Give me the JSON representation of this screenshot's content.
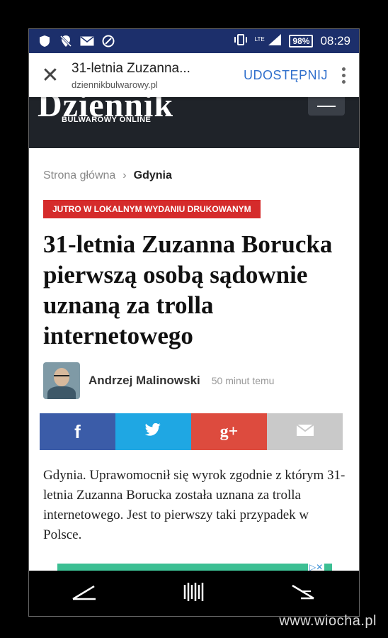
{
  "status_bar": {
    "battery": "98%",
    "network": "LTE",
    "time": "08:29"
  },
  "tab_bar": {
    "title": "31-letnia Zuzanna...",
    "url": "dziennikbulwarowy.pl",
    "share_label": "UDOSTĘPNIJ"
  },
  "site": {
    "logo": "Dziennik",
    "logo_sub": "BULWAROWY ONLINE"
  },
  "article": {
    "breadcrumb_home": "Strona główna",
    "breadcrumb_sep": "›",
    "breadcrumb_current": "Gdynia",
    "badge": "JUTRO W LOKALNYM WYDANIU DRUKOWANYM",
    "headline": "31-letnia Zuzanna Borucka pierwszą osobą sądownie uznaną za trolla internetowego",
    "author": "Andrzej Malinowski",
    "time": "50 minut temu",
    "lead": "Gdynia. Uprawomocnił się wyrok zgodnie z którym 31-letnia Zuzanna Borucka została uznana za trolla internetowego. Jest to pierwszy taki przypadek w Polsce."
  },
  "share_buttons": {
    "facebook": "f",
    "googleplus": "g+"
  },
  "watermark": "www.wiocha.pl",
  "colors": {
    "status_bar": "#1c2f6b",
    "header": "#1f2329",
    "badge": "#d52b2b",
    "facebook": "#3b5ca8",
    "twitter": "#1fa7e3",
    "googleplus": "#dd4b3e",
    "mail": "#c9c9c9",
    "share_link": "#2f6fcc"
  }
}
